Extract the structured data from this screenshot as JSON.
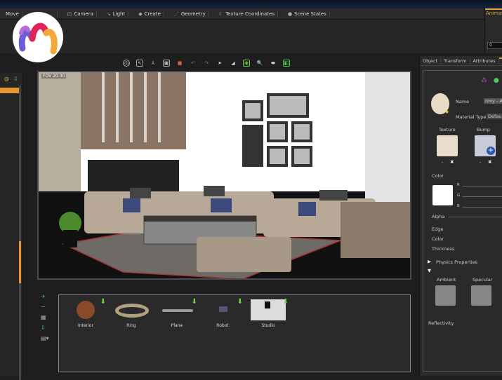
{
  "menubar": {
    "items": [
      {
        "label": "Move",
        "icon": "move-icon"
      },
      {
        "label": "",
        "icon": "select-icon"
      },
      {
        "label": "Camera",
        "icon": "camera-icon"
      },
      {
        "label": "Light",
        "icon": "light-icon"
      },
      {
        "label": "Create",
        "icon": "create-icon"
      },
      {
        "label": "Geometry",
        "icon": "geometry-icon"
      },
      {
        "label": "Texture Coordinates",
        "icon": "texture-coordinates-icon"
      },
      {
        "label": "Scene States",
        "icon": "scene-states-icon"
      }
    ]
  },
  "animation": {
    "label": "Animati",
    "frame": "0"
  },
  "viewport": {
    "fov": "FOV 20.00"
  },
  "library": {
    "assets": [
      {
        "name": "Interior"
      },
      {
        "name": "Ring"
      },
      {
        "name": "Plane"
      },
      {
        "name": "Robot"
      },
      {
        "name": "Studio"
      }
    ]
  },
  "right_panel": {
    "tabs": [
      "Object",
      "Transform",
      "Attributes",
      "Ma"
    ],
    "name_label": "Name",
    "name_value": "roxy - Ar",
    "material_type_label": "Material Type",
    "material_type_value": "Default",
    "texture_label": "Texture",
    "bump_label": "Bump",
    "color_label": "Color",
    "r": "R",
    "g": "G",
    "b": "B",
    "alpha": "Alpha",
    "edge": "Edge",
    "edge_color": "Color",
    "thickness": "Thickness",
    "physics": "Physics Properties",
    "ambient": "Ambient",
    "specular": "Specular",
    "reflectivity": "Reflectivity"
  },
  "colors": {
    "accent": "#e8962e",
    "background": "#262626",
    "download": "#66dd44"
  }
}
